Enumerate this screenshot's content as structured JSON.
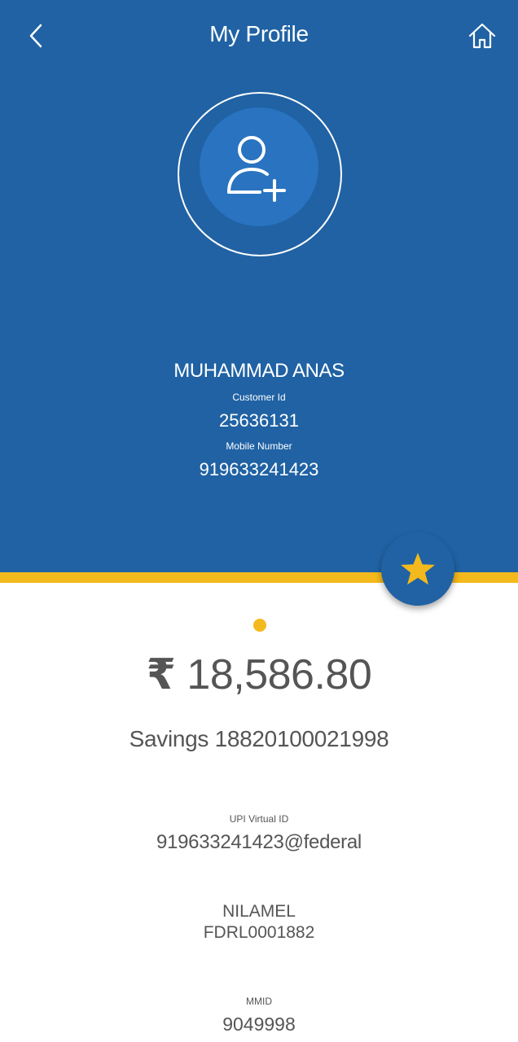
{
  "header": {
    "title": "My Profile",
    "back_icon": "chevron-left-icon",
    "home_icon": "home-icon",
    "background_color": "#2062a4",
    "accent_color": "#f4b91c"
  },
  "profile": {
    "avatar_icon": "add-user-icon",
    "name": "MUHAMMAD ANAS",
    "customer_id_label": "Customer Id",
    "customer_id": "25636131",
    "mobile_label": "Mobile Number",
    "mobile": "919633241423"
  },
  "favorite_button": {
    "icon": "star-icon"
  },
  "account": {
    "currency_symbol": "₹",
    "balance": "18,586.80",
    "account_label": "Savings 18820100021998",
    "upi_label": "UPI Virtual ID",
    "upi_id": "919633241423@federal",
    "branch_name": "NILAMEL",
    "ifsc": "FDRL0001882",
    "mmid_label": "MMID",
    "mmid": "9049998"
  }
}
